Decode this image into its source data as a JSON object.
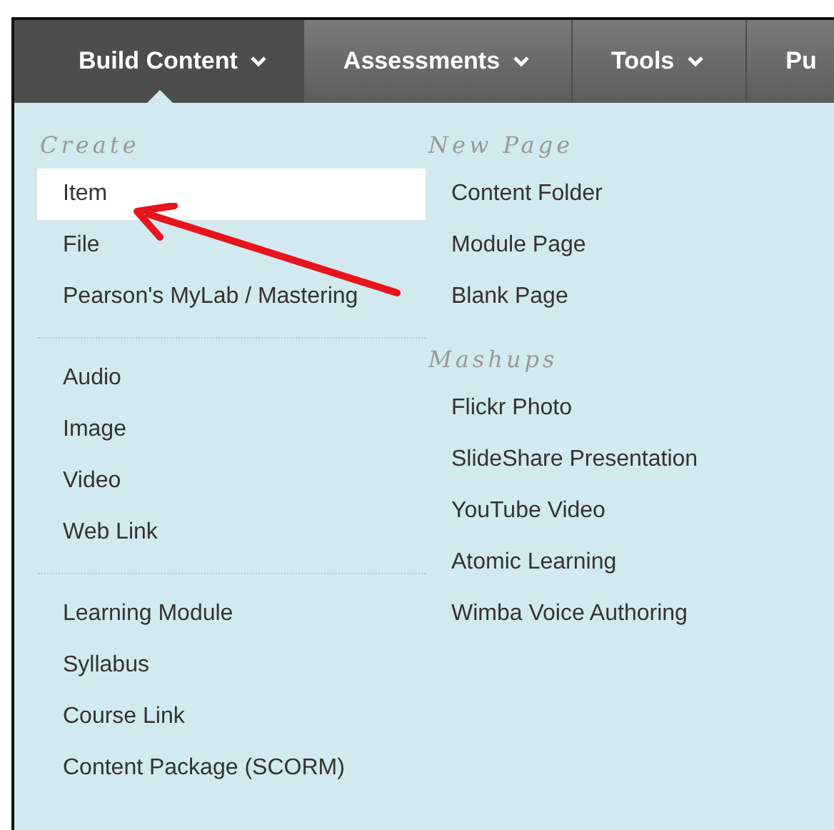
{
  "tabs": [
    {
      "label": "Build Content",
      "selected": true
    },
    {
      "label": "Assessments",
      "selected": false
    },
    {
      "label": "Tools",
      "selected": false
    },
    {
      "label": "Pu",
      "selected": false
    }
  ],
  "menu": {
    "columns": [
      {
        "groups": [
          {
            "heading": "Create",
            "items": [
              {
                "label": "Item",
                "selected": true
              },
              {
                "label": "File",
                "selected": false
              },
              {
                "label": "Pearson's MyLab / Mastering",
                "selected": false
              }
            ]
          },
          {
            "items": [
              {
                "label": "Audio",
                "selected": false
              },
              {
                "label": "Image",
                "selected": false
              },
              {
                "label": "Video",
                "selected": false
              },
              {
                "label": "Web Link",
                "selected": false
              }
            ]
          },
          {
            "items": [
              {
                "label": "Learning Module",
                "selected": false
              },
              {
                "label": "Syllabus",
                "selected": false
              },
              {
                "label": "Course Link",
                "selected": false
              },
              {
                "label": "Content Package (SCORM)",
                "selected": false
              }
            ]
          }
        ]
      },
      {
        "groups": [
          {
            "heading": "New Page",
            "items": [
              {
                "label": "Content Folder",
                "selected": false
              },
              {
                "label": "Module Page",
                "selected": false
              },
              {
                "label": "Blank Page",
                "selected": false
              }
            ]
          },
          {
            "heading": "Mashups",
            "items": [
              {
                "label": "Flickr Photo",
                "selected": false
              },
              {
                "label": "SlideShare Presentation",
                "selected": false
              },
              {
                "label": "YouTube Video",
                "selected": false
              },
              {
                "label": "Atomic Learning",
                "selected": false
              },
              {
                "label": "Wimba Voice Authoring",
                "selected": false
              }
            ]
          }
        ]
      }
    ]
  }
}
